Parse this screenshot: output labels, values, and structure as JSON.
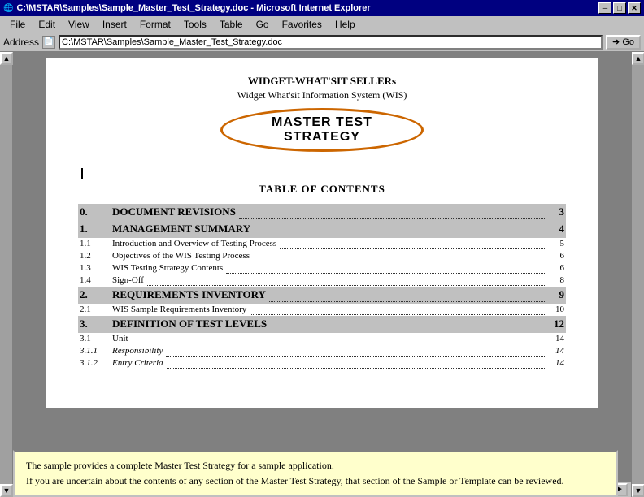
{
  "titlebar": {
    "title": "C:\\MSTAR\\Samples\\Sample_Master_Test_Strategy.doc - Microsoft Internet Explorer",
    "minimize": "─",
    "maximize": "□",
    "close": "✕"
  },
  "menubar": {
    "items": [
      "File",
      "Edit",
      "View",
      "Insert",
      "Format",
      "Tools",
      "Table",
      "Go",
      "Favorites",
      "Help"
    ]
  },
  "addressbar": {
    "label": "Address",
    "value": "C:\\MSTAR\\Samples\\Sample_Master_Test_Strategy.doc",
    "go_label": "➜ Go"
  },
  "document": {
    "title_main": "WIDGET-WHAT'SIT SELLERs",
    "subtitle": "Widget What'sit Information System (WIS)",
    "master_title": "MASTER TEST STRATEGY",
    "toc_heading": "TABLE OF CONTENTS",
    "toc_entries": [
      {
        "num": "0.",
        "text": "DOCUMENT REVISIONS",
        "dots": true,
        "page": "3",
        "major": true
      },
      {
        "num": "1.",
        "text": "MANAGEMENT SUMMARY",
        "dots": true,
        "page": "4",
        "major": true
      },
      {
        "num": "1.1",
        "text": "Introduction and Overview of Testing Process",
        "dots": true,
        "page": "5",
        "major": false
      },
      {
        "num": "1.2",
        "text": "Objectives of the WIS Testing Process",
        "dots": true,
        "page": "6",
        "major": false
      },
      {
        "num": "1.3",
        "text": "WIS Testing Strategy Contents",
        "dots": true,
        "page": "6",
        "major": false
      },
      {
        "num": "1.4",
        "text": "Sign-Off",
        "dots": true,
        "page": "8",
        "major": false
      },
      {
        "num": "2.",
        "text": "REQUIREMENTS INVENTORY",
        "dots": true,
        "page": "9",
        "major": true
      },
      {
        "num": "2.1",
        "text": "WIS Sample Requirements Inventory",
        "dots": true,
        "page": "10",
        "major": false
      },
      {
        "num": "3.",
        "text": "DEFINITION OF TEST LEVELS",
        "dots": true,
        "page": "12",
        "major": true
      },
      {
        "num": "3.1",
        "text": "Unit",
        "dots": true,
        "page": "14",
        "major": false
      },
      {
        "num": "3.1.1",
        "text": "Responsibility",
        "dots": true,
        "page": "14",
        "major": false,
        "italic": true
      },
      {
        "num": "3.1.2",
        "text": "Entry Criteria",
        "dots": true,
        "page": "14",
        "major": false,
        "italic": true
      }
    ]
  },
  "infobox": {
    "line1": "The sample provides a complete Master Test Strategy for a sample application.",
    "line2": "If you are uncertain about the contents of any section of the Master Test Strategy,  that section of the Sample or Template can be reviewed."
  },
  "icons": {
    "ie_logo": "e",
    "page_icon": "📄",
    "arrow_right": "→",
    "scroll_up": "▲",
    "scroll_down": "▼",
    "scroll_left": "◄",
    "scroll_right": "►",
    "nav_prev": "◄",
    "nav_next": "►"
  }
}
